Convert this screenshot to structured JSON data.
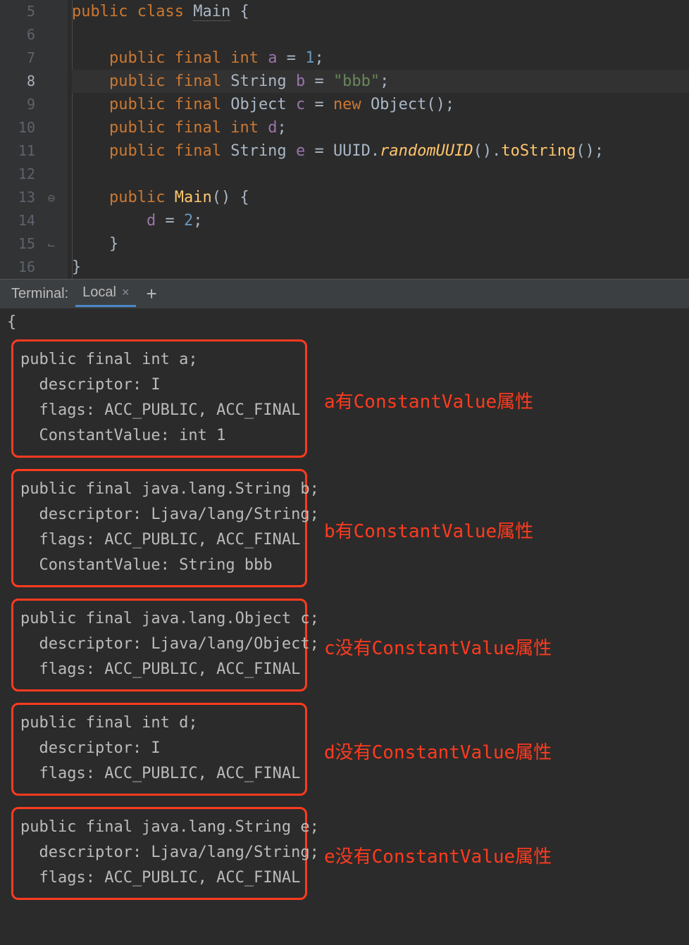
{
  "editor": {
    "lines": [
      {
        "n": "5",
        "cur": false,
        "html": "<span class='kw'>public</span> <span class='kw'>class</span> <span class='cls main-uline'>Main</span> <span class='op'>{</span>"
      },
      {
        "n": "6",
        "cur": false,
        "html": ""
      },
      {
        "n": "7",
        "cur": false,
        "html": "    <span class='kw'>public</span> <span class='kw'>final</span> <span class='kw'>int</span> <span class='fld'>a</span> <span class='op'>=</span> <span class='num'>1</span><span class='op'>;</span>"
      },
      {
        "n": "8",
        "cur": true,
        "html": "    <span class='kw'>public</span> <span class='kw'>final</span> <span class='cls'>String</span> <span class='fld'>b</span> <span class='op'>=</span> <span class='str'>\"bbb\"</span><span class='op'>;</span>"
      },
      {
        "n": "9",
        "cur": false,
        "html": "    <span class='kw'>public</span> <span class='kw'>final</span> <span class='cls'>Object</span> <span class='fld'>c</span> <span class='op'>=</span> <span class='kw'>new</span> <span class='cls'>Object</span><span class='op'>();</span>"
      },
      {
        "n": "10",
        "cur": false,
        "html": "    <span class='kw'>public</span> <span class='kw'>final</span> <span class='kw'>int</span> <span class='fld'>d</span><span class='op'>;</span>"
      },
      {
        "n": "11",
        "cur": false,
        "html": "    <span class='kw'>public</span> <span class='kw'>final</span> <span class='cls'>String</span> <span class='fld'>e</span> <span class='op'>=</span> <span class='cls'>UUID</span><span class='op'>.</span><span class='mthi'>randomUUID</span><span class='op'>().</span><span class='mth'>toString</span><span class='op'>();</span>"
      },
      {
        "n": "12",
        "cur": false,
        "html": ""
      },
      {
        "n": "13",
        "cur": false,
        "html": "    <span class='kw'>public</span> <span class='mth'>Main</span><span class='op'>() {</span>"
      },
      {
        "n": "14",
        "cur": false,
        "html": "        <span class='fld'>d</span> <span class='op'>=</span> <span class='num'>2</span><span class='op'>;</span>"
      },
      {
        "n": "15",
        "cur": false,
        "html": "    <span class='op'>}</span>"
      },
      {
        "n": "16",
        "cur": false,
        "html": "<span class='op'>}</span>"
      }
    ]
  },
  "terminal": {
    "label": "Terminal:",
    "tab": "Local",
    "close": "×",
    "plus": "+",
    "open_brace": "{",
    "boxes": [
      {
        "lines": [
          "public final int a;",
          "  descriptor: I",
          "  flags: ACC_PUBLIC, ACC_FINAL",
          "  ConstantValue: int 1"
        ],
        "annot": "a有ConstantValue属性"
      },
      {
        "lines": [
          "public final java.lang.String b;",
          "  descriptor: Ljava/lang/String;",
          "  flags: ACC_PUBLIC, ACC_FINAL",
          "  ConstantValue: String bbb"
        ],
        "annot": "b有ConstantValue属性"
      },
      {
        "lines": [
          "public final java.lang.Object c;",
          "  descriptor: Ljava/lang/Object;",
          "  flags: ACC_PUBLIC, ACC_FINAL"
        ],
        "annot": "c没有ConstantValue属性"
      },
      {
        "lines": [
          "public final int d;",
          "  descriptor: I",
          "  flags: ACC_PUBLIC, ACC_FINAL"
        ],
        "annot": "d没有ConstantValue属性"
      },
      {
        "lines": [
          "public final java.lang.String e;",
          "  descriptor: Ljava/lang/String;",
          "  flags: ACC_PUBLIC, ACC_FINAL"
        ],
        "annot": "e没有ConstantValue属性"
      }
    ]
  }
}
